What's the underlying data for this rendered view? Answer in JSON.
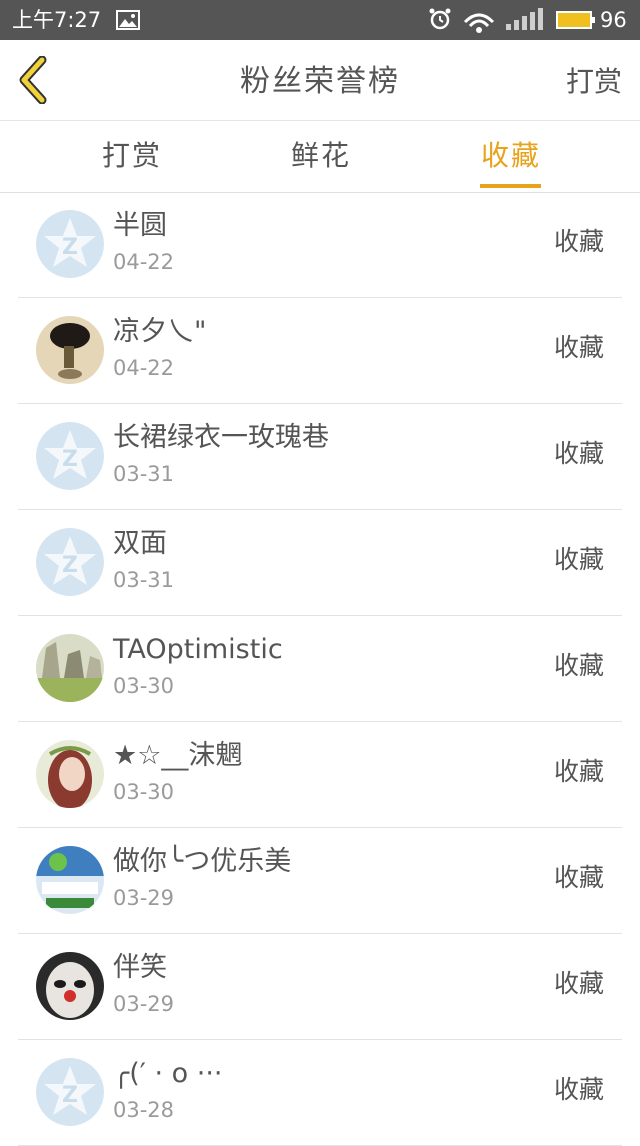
{
  "status_bar": {
    "time": "上午7:27",
    "battery": "96"
  },
  "header": {
    "title": "粉丝荣誉榜",
    "action_label": "打赏"
  },
  "tabs": [
    {
      "label": "打赏",
      "active": false
    },
    {
      "label": "鲜花",
      "active": false
    },
    {
      "label": "收藏",
      "active": true
    }
  ],
  "colors": {
    "accent": "#e8a21b",
    "status_bar": "#555555",
    "text": "#555555",
    "subtext": "#9a9a9a"
  },
  "fans": [
    {
      "name": "半圆",
      "date": "04-22",
      "action": "收藏",
      "avatar": "default-qq-avatar-icon"
    },
    {
      "name": "凉夕乀\"",
      "date": "04-22",
      "action": "收藏",
      "avatar": "user-photo-avatar"
    },
    {
      "name": "长裙绿衣一玫瑰巷",
      "date": "03-31",
      "action": "收藏",
      "avatar": "default-qq-avatar-icon"
    },
    {
      "name": "双面",
      "date": "03-31",
      "action": "收藏",
      "avatar": "default-qq-avatar-icon"
    },
    {
      "name": "TAOptimistic",
      "date": "03-30",
      "action": "收藏",
      "avatar": "user-photo-avatar"
    },
    {
      "name": "★☆__沫魍",
      "date": "03-30",
      "action": "收藏",
      "avatar": "user-photo-avatar"
    },
    {
      "name": "做你╰つ优乐美",
      "date": "03-29",
      "action": "收藏",
      "avatar": "user-photo-avatar"
    },
    {
      "name": "伴笑",
      "date": "03-29",
      "action": "收藏",
      "avatar": "user-photo-avatar"
    },
    {
      "name": "╭(′ · o ···",
      "date": "03-28",
      "action": "收藏",
      "avatar": "default-qq-avatar-icon"
    }
  ]
}
